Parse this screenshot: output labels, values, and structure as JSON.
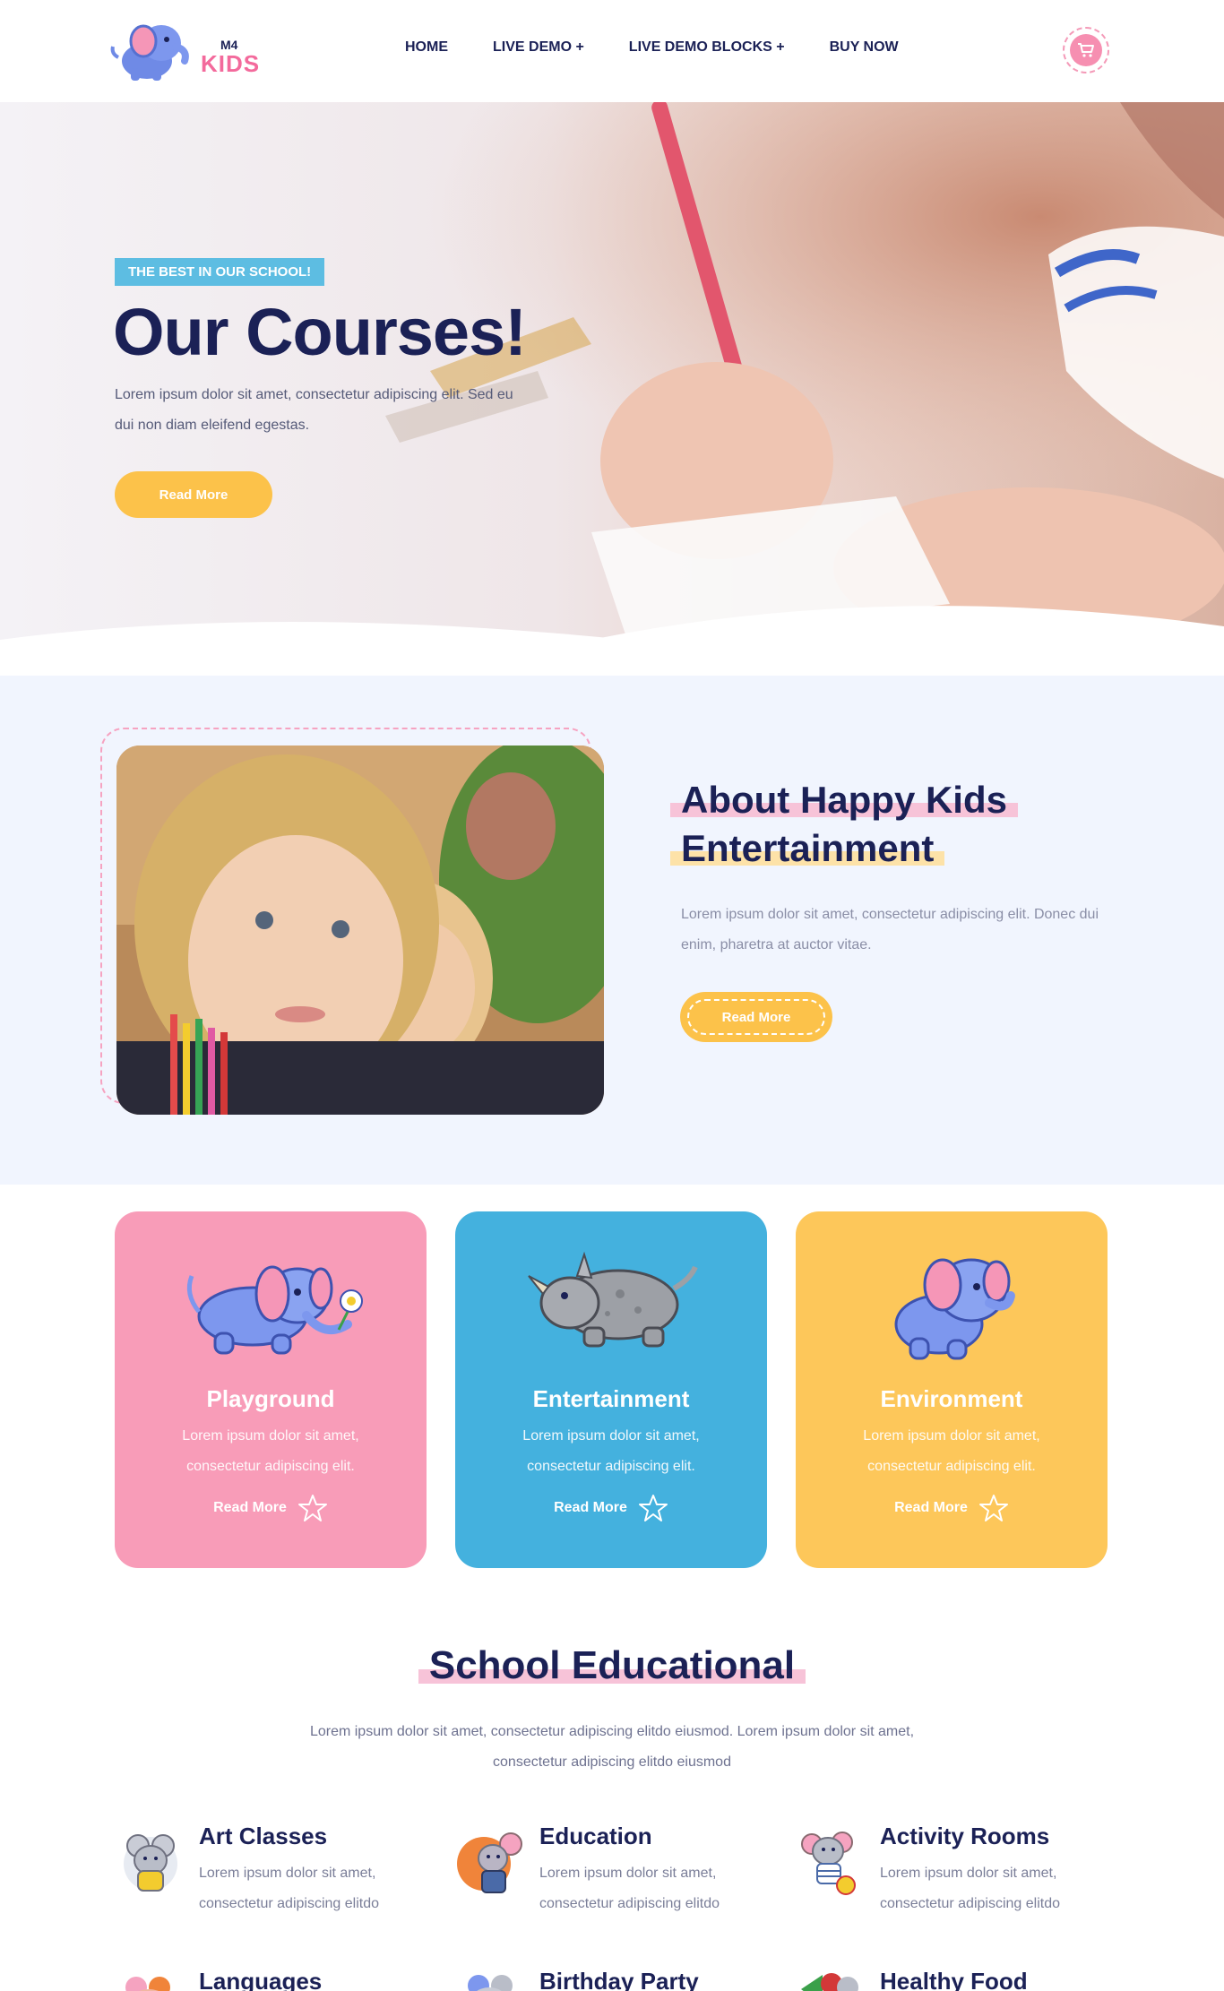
{
  "header": {
    "logo_top": "M4",
    "logo_bottom": "KIDS",
    "nav": [
      "HOME",
      "LIVE DEMO +",
      "LIVE DEMO BLOCKS +",
      "BUY NOW"
    ]
  },
  "hero": {
    "badge": "THE BEST IN OUR SCHOOL!",
    "title": "Our Courses!",
    "text": "Lorem ipsum dolor sit amet, consectetur adipiscing elit. Sed eu dui non diam eleifend egestas.",
    "button": "Read More"
  },
  "about": {
    "title_line1": "About Happy Kids",
    "title_line2": "Entertainment",
    "text": "Lorem ipsum dolor sit amet, consectetur adipiscing elit. Donec dui enim, pharetra at auctor vitae.",
    "button": "Read More"
  },
  "cards": [
    {
      "title": "Playground",
      "text": "Lorem ipsum dolor sit amet, consectetur adipiscing elit.",
      "link": "Read More",
      "color": "#f89cb8",
      "icon": "elephant-flower-icon"
    },
    {
      "title": "Entertainment",
      "text": "Lorem ipsum dolor sit amet, consectetur adipiscing elit.",
      "link": "Read More",
      "color": "#44b1de",
      "icon": "rhino-icon"
    },
    {
      "title": "Environment",
      "text": "Lorem ipsum dolor sit amet, consectetur adipiscing elit.",
      "link": "Read More",
      "color": "#fdc75a",
      "icon": "elephant-icon"
    }
  ],
  "school": {
    "title": "School Educational",
    "text": "Lorem ipsum dolor sit amet, consectetur adipiscing elitdo eiusmod. Lorem ipsum dolor sit amet, consectetur adipiscing elitdo eiusmod"
  },
  "features": [
    {
      "title": "Art Classes",
      "text": "Lorem ipsum dolor sit amet, consectetur adipiscing elitdo",
      "icon": "mouse-painter-icon"
    },
    {
      "title": "Education",
      "text": "Lorem ipsum dolor sit amet, consectetur adipiscing elitdo",
      "icon": "fox-teacher-icon"
    },
    {
      "title": "Activity Rooms",
      "text": "Lorem ipsum dolor sit amet, consectetur adipiscing elitdo",
      "icon": "elephant-ball-icon"
    },
    {
      "title": "Languages",
      "icon": "hippo-icon"
    },
    {
      "title": "Birthday Party",
      "icon": "party-animal-icon"
    },
    {
      "title": "Healthy Food",
      "icon": "food-icon"
    }
  ],
  "colors": {
    "navy": "#1b2156",
    "pink": "#f36a9c",
    "yellow": "#fcc24a",
    "blue": "#5dbde2",
    "about_bg": "#f1f5fe"
  }
}
